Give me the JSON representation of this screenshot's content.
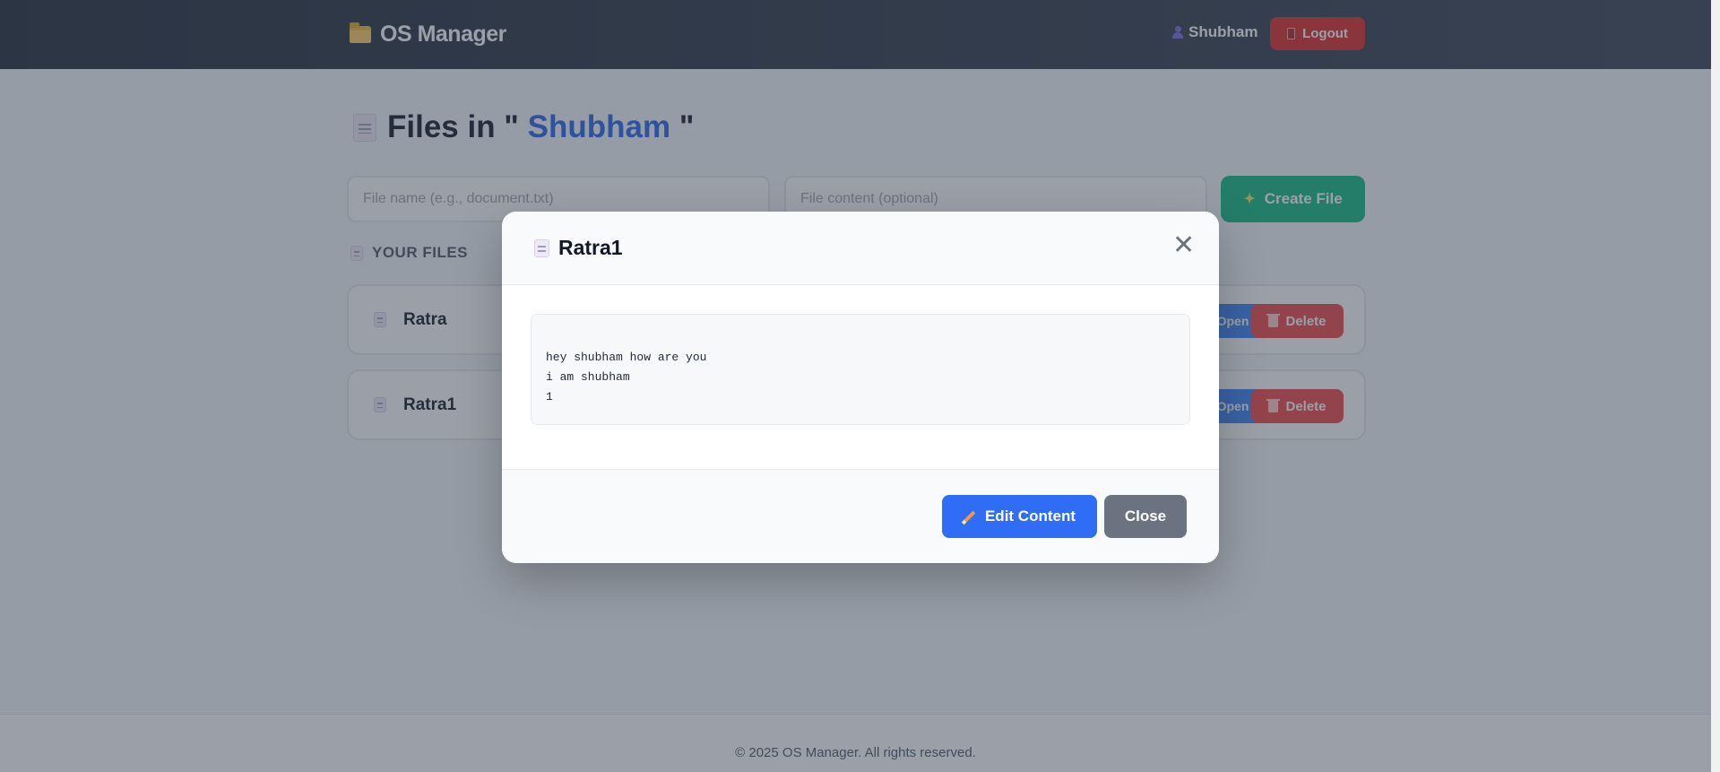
{
  "navbar": {
    "brand": "OS Manager",
    "username": "Shubham",
    "logout_label": "Logout"
  },
  "main": {
    "title_prefix": "Files in \"",
    "title_folder": "Shubham",
    "title_suffix": "\"",
    "filename_placeholder": "File name (e.g., document.txt)",
    "content_placeholder": "File content (optional)",
    "create_label": "Create File",
    "section_label": "YOUR FILES",
    "files": [
      {
        "name": "Ratra",
        "open_label": "Open",
        "delete_label": "Delete"
      },
      {
        "name": "Ratra1",
        "open_label": "Open",
        "delete_label": "Delete"
      }
    ]
  },
  "footer": {
    "text": "© 2025 OS Manager. All rights reserved."
  },
  "modal": {
    "title": "Ratra1",
    "close_symbol": "✕",
    "content_lines": [
      "hey shubham how are you",
      "i am shubham",
      "1"
    ],
    "edit_label": "Edit Content",
    "close_label": "Close"
  },
  "colors": {
    "navbar": "#1f2937",
    "accent_blue": "#2563eb",
    "create_green": "#10b981",
    "delete_red": "#ef4444",
    "close_gray": "#6b7280"
  },
  "icons": {
    "brand": "folder-icon",
    "user": "user-icon",
    "logout": "door-icon",
    "title": "document-icon",
    "create": "sparkle-icon",
    "delete": "trash-icon",
    "edit": "pencil-icon",
    "close": "close-icon"
  }
}
